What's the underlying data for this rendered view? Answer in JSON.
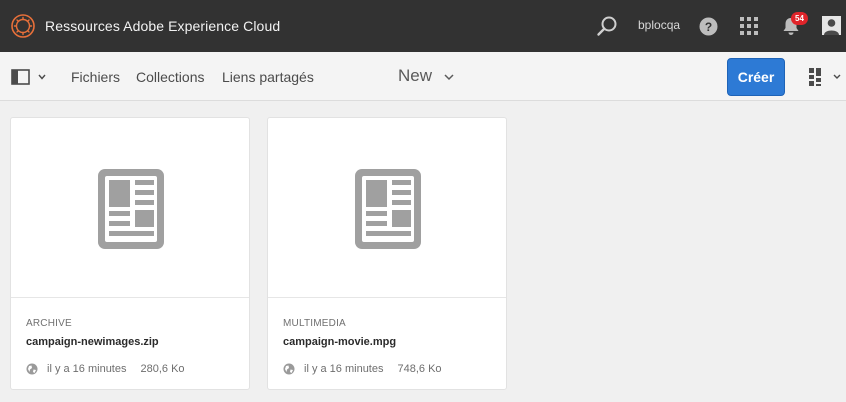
{
  "shell": {
    "title": "Ressources Adobe Experience Cloud",
    "user": "bplocqa",
    "notification_count": "54"
  },
  "actionbar": {
    "nav": [
      "Fichiers",
      "Collections",
      "Liens partagés"
    ],
    "new_label": "New",
    "create_label": "Créer"
  },
  "cards": [
    {
      "type": "ARCHIVE",
      "name": "campaign-newimages.zip",
      "modified": "il y a 16 minutes",
      "size": "280,6 Ko"
    },
    {
      "type": "MULTIMEDIA",
      "name": "campaign-movie.mpg",
      "modified": "il y a 16 minutes",
      "size": "748,6 Ko"
    }
  ],
  "colors": {
    "shell_bg": "#323232",
    "accent": "#2d7ad5",
    "badge": "#e0242a",
    "logo": "#e8703a"
  }
}
